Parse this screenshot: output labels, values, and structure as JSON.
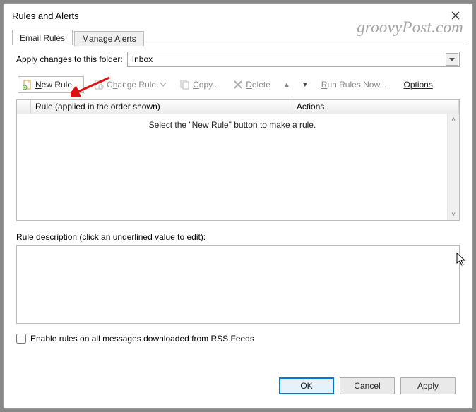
{
  "window": {
    "title": "Rules and Alerts"
  },
  "tabs": {
    "email_rules": "Email Rules",
    "manage_alerts": "Manage Alerts"
  },
  "folder": {
    "label": "Apply changes to this folder:",
    "selected": "Inbox"
  },
  "toolbar": {
    "new_rule": "New Rule...",
    "new_rule_u": "N",
    "change_rule": "Change Rule",
    "change_rule_u": "h",
    "copy": "Copy...",
    "copy_u": "C",
    "delete": "Delete",
    "delete_u": "D",
    "run_rules": "Run Rules Now...",
    "run_rules_u": "R",
    "options": "Options",
    "options_u": "O"
  },
  "list": {
    "header_rule": "Rule (applied in the order shown)",
    "header_actions": "Actions",
    "empty_msg": "Select the \"New Rule\" button to make a rule."
  },
  "description": {
    "label": "Rule description (click an underlined value to edit):"
  },
  "checkbox": {
    "rss": "Enable rules on all messages downloaded from RSS Feeds"
  },
  "buttons": {
    "ok": "OK",
    "cancel": "Cancel",
    "apply": "Apply"
  },
  "watermark": "groovyPost.com"
}
